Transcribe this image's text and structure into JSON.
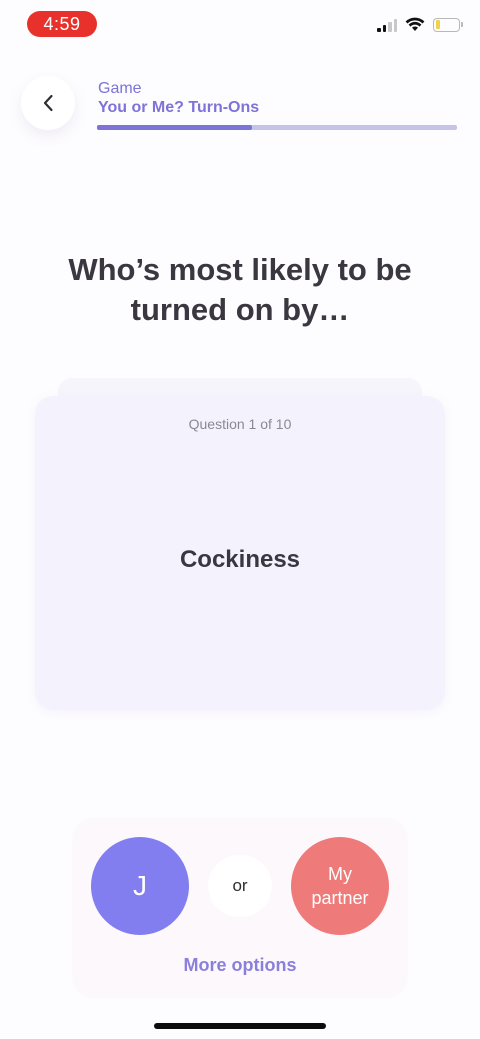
{
  "status_bar": {
    "time": "4:59",
    "signal_bars_active": 2,
    "signal_bars_total": 4,
    "battery_level": 0.15,
    "battery_color": "#f2d24b"
  },
  "header": {
    "back_icon": "chevron-left-icon",
    "subtitle": "Game",
    "title": "You or Me? Turn-Ons",
    "progress": 0.43,
    "accent_color": "#7d73d8"
  },
  "prompt": {
    "text": "Who’s most likely to be turned on by…"
  },
  "card": {
    "counter": "Question 1 of 10",
    "answer": "Cockiness"
  },
  "choices": {
    "me_label": "J",
    "me_color": "#837ef0",
    "or_label": "or",
    "partner_label": "My partner",
    "partner_color": "#ef7a7a",
    "more_options": "More options"
  }
}
